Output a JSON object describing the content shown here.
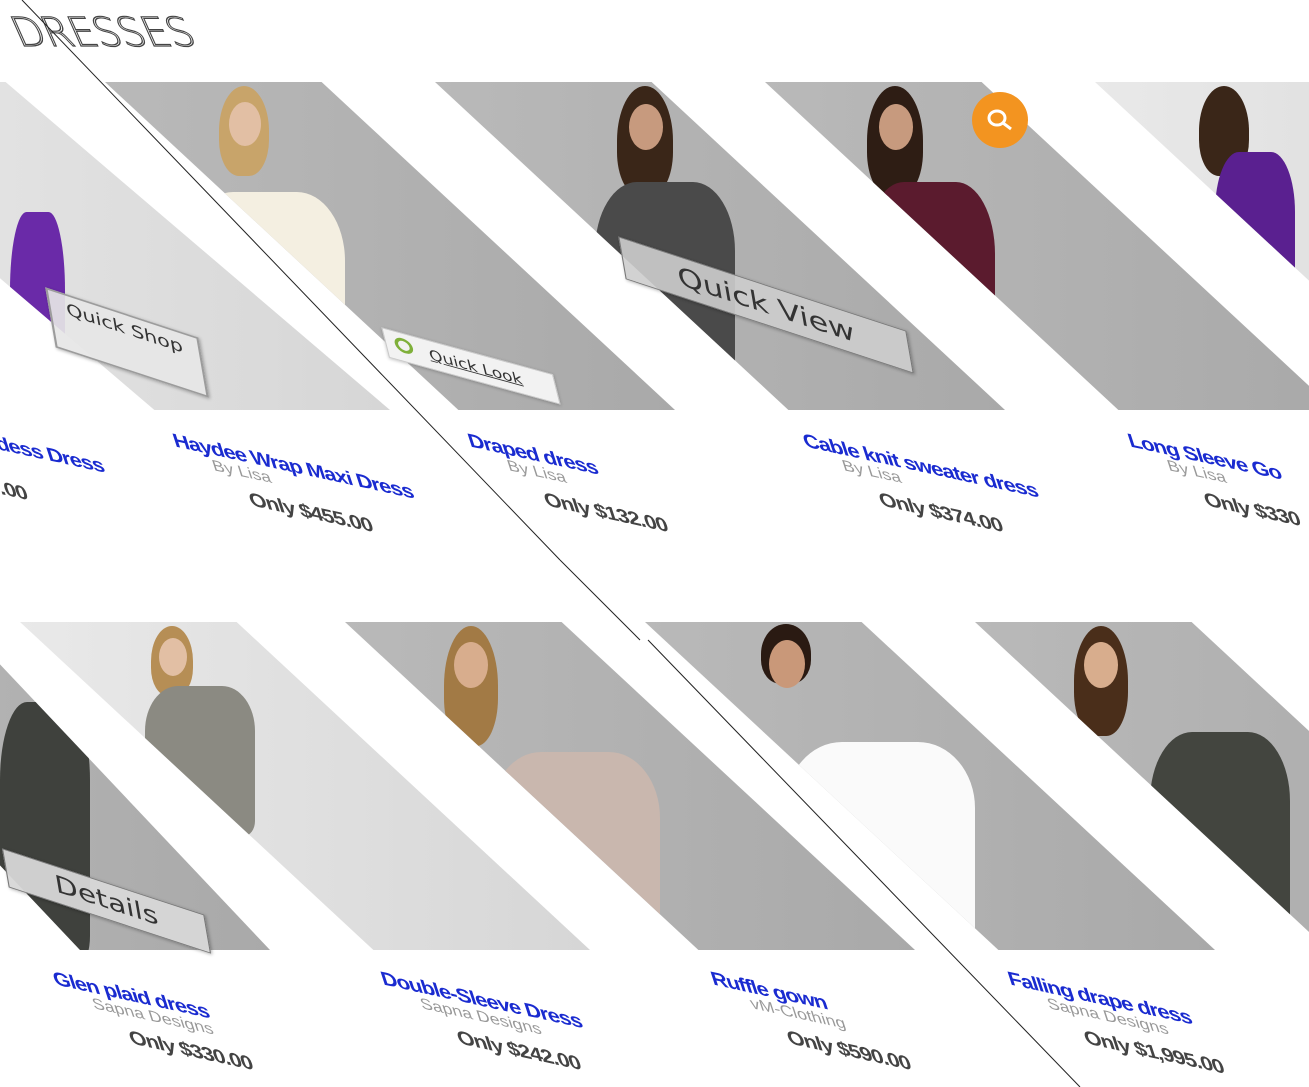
{
  "page_title": "DRESSES",
  "overlays": {
    "quick_shop": "Quick Shop",
    "quick_look": "Quick Look",
    "quick_view": "Quick View",
    "details": "Details"
  },
  "accent_color": "#f39420",
  "products": [
    {
      "name": "ddess Dress",
      "by": "",
      "price": ".00"
    },
    {
      "name": "Haydee Wrap Maxi Dress",
      "by": "By Lisa",
      "price": "Only $455.00"
    },
    {
      "name": "Draped dress",
      "by": "By Lisa",
      "price": "Only $132.00"
    },
    {
      "name": "Cable knit sweater dress",
      "by": "By Lisa",
      "price": "Only $374.00"
    },
    {
      "name": "Long Sleeve Go",
      "by": "By Lisa",
      "price": "Only $330"
    },
    {
      "name": "Glen plaid dress",
      "by": "Sapna Designs",
      "price": "Only $330.00"
    },
    {
      "name": "Double-Sleeve Dress",
      "by": "Sapna Designs",
      "price": "Only $242.00"
    },
    {
      "name": "Ruffle gown",
      "by": "vM-Clothing",
      "price": "Only $590.00"
    },
    {
      "name": "Falling drape dress",
      "by": "Sapna Designs",
      "price": "Only $1,995.00"
    }
  ]
}
